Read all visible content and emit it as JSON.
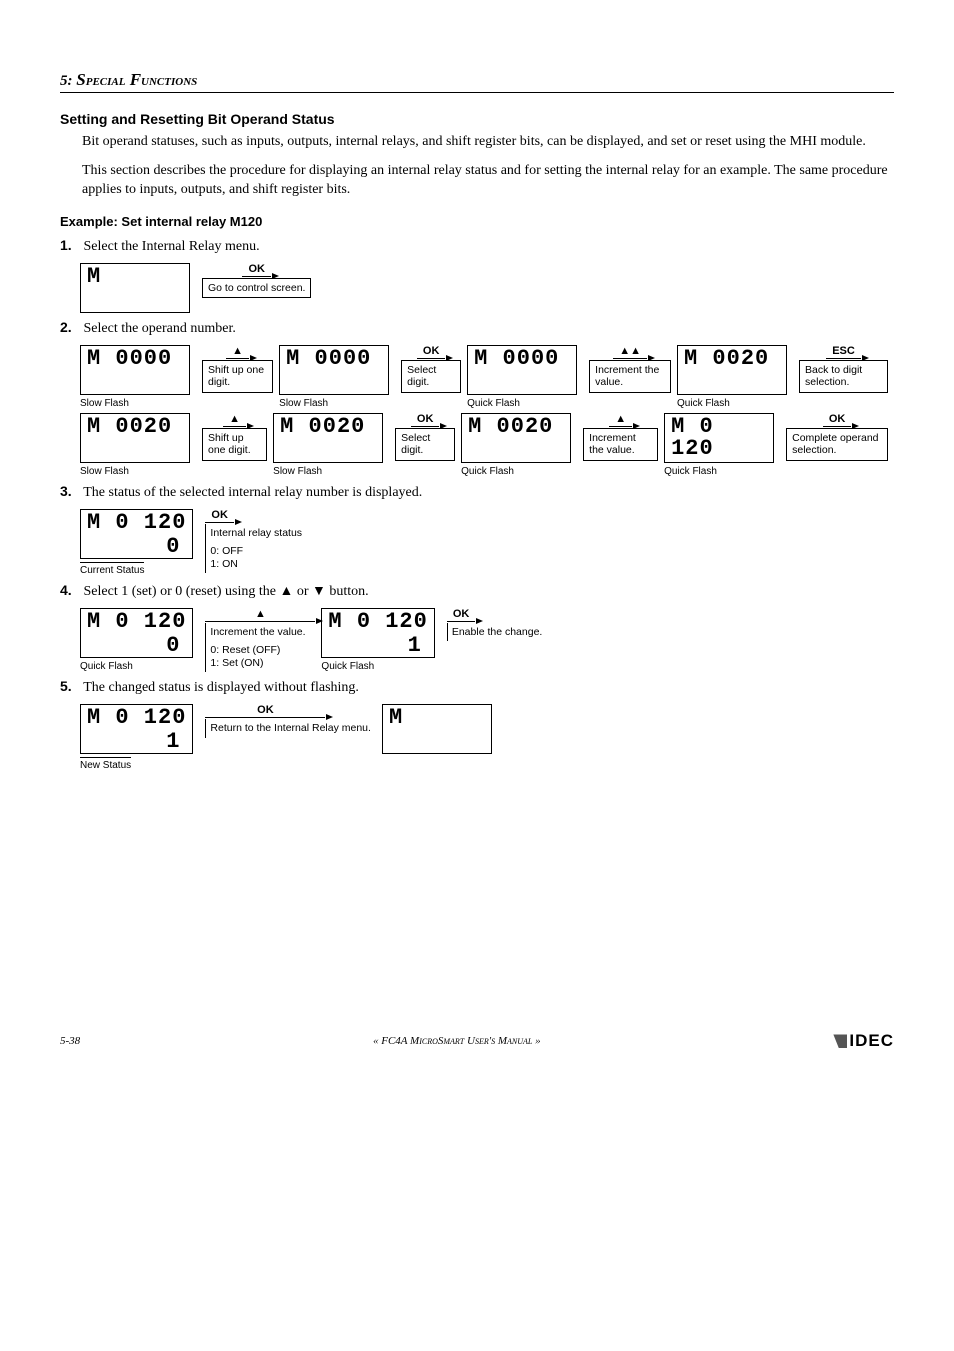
{
  "chapter": {
    "num": "5:",
    "title_part1": "S",
    "title_part2": "pecial",
    "title_part3": " F",
    "title_part4": "unctions"
  },
  "section": {
    "title": "Setting and Resetting Bit Operand Status",
    "p1": "Bit operand statuses, such as inputs, outputs, internal relays, and shift register bits, can be displayed, and set or reset using the MHI module.",
    "p2": "This section describes the procedure for displaying an internal relay status and for setting the internal relay for an example. The same procedure applies to inputs, outputs, and shift register bits."
  },
  "example_heading": "Example: Set internal relay M120",
  "steps": {
    "s1": {
      "num": "1.",
      "text": "Select the Internal Relay menu."
    },
    "s2": {
      "num": "2.",
      "text": "Select the operand number."
    },
    "s3": {
      "num": "3.",
      "text": "The status of the selected internal relay number is displayed."
    },
    "s4": {
      "num": "4.",
      "text_pre": "Select 1 (set) or 0 (reset) using the ",
      "text_mid": " or ",
      "text_post": " button."
    },
    "s5": {
      "num": "5.",
      "text": "The changed status is displayed without flashing."
    }
  },
  "keys": {
    "ok": "OK",
    "esc": "ESC",
    "up": "▲",
    "upup": "▲▲"
  },
  "captions": {
    "slow": "Slow Flash",
    "quick": "Quick Flash",
    "current_status": "Current Status",
    "new_status": "New Status"
  },
  "actions": {
    "go_control": "Go to control screen.",
    "shift_up": "Shift up one digit.",
    "select_digit": "Select digit.",
    "increment": "Increment the value.",
    "back_digit": "Back to digit selection.",
    "complete": "Complete operand selection.",
    "relay_status": "Internal relay status",
    "off_on": "0: OFF\n1: ON",
    "increment_val": "Increment the value.",
    "reset_set": "0: Reset (OFF)\n1: Set (ON)",
    "enable": "Enable the change.",
    "return_menu": "Return to the Internal Relay menu."
  },
  "lcd": {
    "M": "M",
    "M0000": "M 0000",
    "M0020": "M 0020",
    "M0120_top": "M 0 120",
    "zero": "0",
    "one": "1"
  },
  "footer": {
    "page": "5-38",
    "manual": "« FC4A MicroSmart User's Manual »",
    "brand": "IDEC"
  }
}
